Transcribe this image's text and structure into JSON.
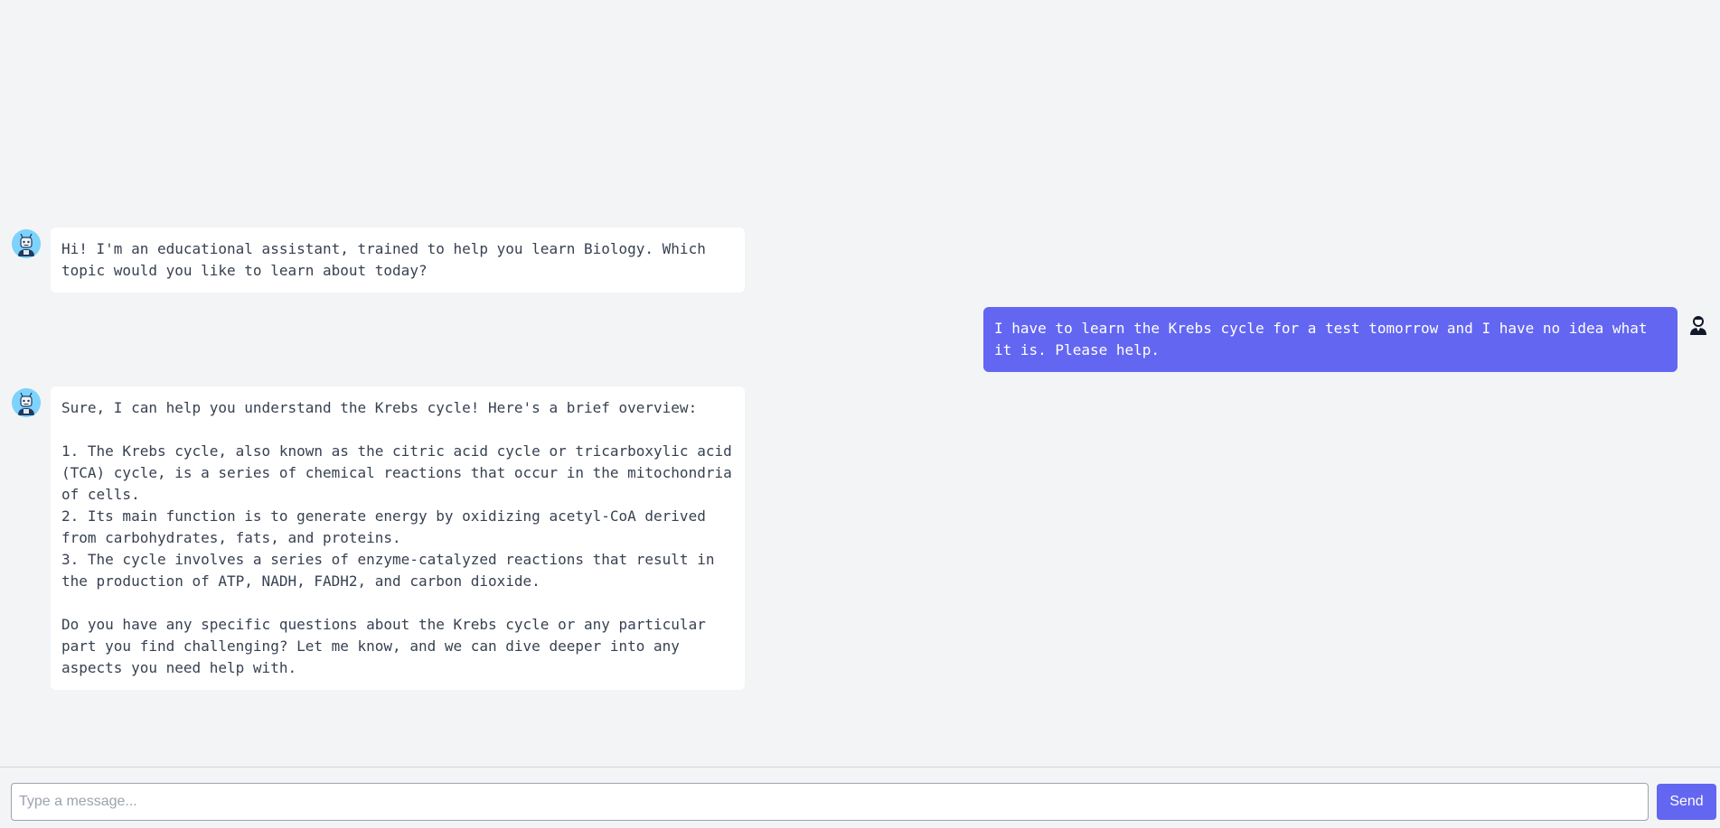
{
  "messages": [
    {
      "role": "bot",
      "text": "Hi! I'm an educational assistant, trained to help you learn Biology. Which topic would you like to learn about today?"
    },
    {
      "role": "user",
      "text": "I have to learn the Krebs cycle for a test tomorrow and I have no idea what it is. Please help."
    },
    {
      "role": "bot",
      "text": "Sure, I can help you understand the Krebs cycle! Here's a brief overview:\n\n1. The Krebs cycle, also known as the citric acid cycle or tricarboxylic acid (TCA) cycle, is a series of chemical reactions that occur in the mitochondria of cells.\n2. Its main function is to generate energy by oxidizing acetyl-CoA derived from carbohydrates, fats, and proteins.\n3. The cycle involves a series of enzyme-catalyzed reactions that result in the production of ATP, NADH, FADH2, and carbon dioxide.\n\nDo you have any specific questions about the Krebs cycle or any particular part you find challenging? Let me know, and we can dive deeper into any aspects you need help with."
    }
  ],
  "icons": {
    "bot_avatar": "robot-avatar-icon",
    "user_avatar": "user-avatar-icon"
  },
  "composer": {
    "placeholder": "Type a message...",
    "value": "",
    "send_label": "Send"
  },
  "colors": {
    "background": "#f3f4f6",
    "accent": "#6366f1",
    "bot_bubble": "#ffffff",
    "bot_avatar_bg": "#7dd3fc"
  }
}
